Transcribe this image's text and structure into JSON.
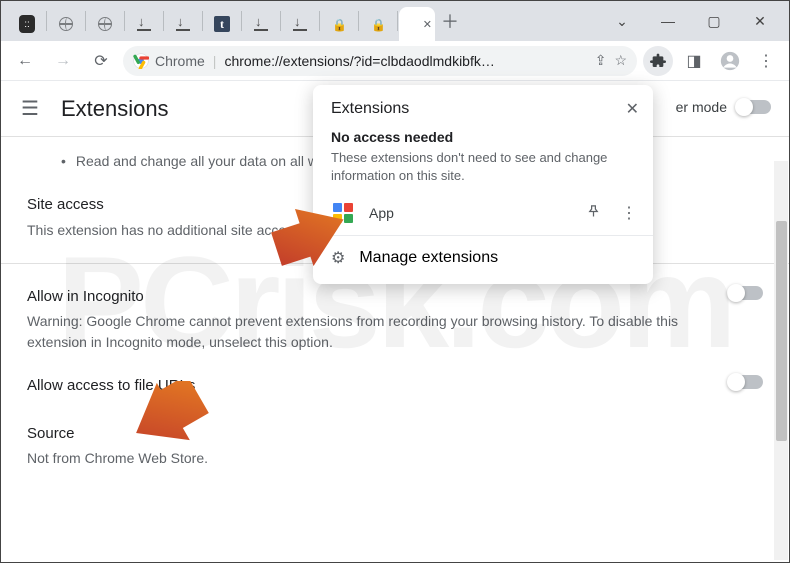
{
  "window": {
    "tabs": [
      {
        "icon": "bot"
      },
      {
        "icon": "globe"
      },
      {
        "icon": "globe"
      },
      {
        "icon": "dl"
      },
      {
        "icon": "dl"
      },
      {
        "icon": "t"
      },
      {
        "icon": "dl"
      },
      {
        "icon": "dl"
      },
      {
        "icon": "lock"
      },
      {
        "icon": "lock"
      },
      {
        "icon": "active",
        "active": true
      }
    ]
  },
  "omnibox": {
    "scheme_label": "Chrome",
    "url": "chrome://extensions/?id=clbdaodlmdkibfk…"
  },
  "page": {
    "title": "Extensions",
    "dev_mode_label": "er mode",
    "bullet": "Read and change all your data on all w",
    "site_access": {
      "title": "Site access",
      "text": "This extension has no additional site acce"
    },
    "incognito": {
      "title": "Allow in Incognito",
      "text": "Warning: Google Chrome cannot prevent extensions from recording your browsing history. To disable this extension in Incognito mode, unselect this option."
    },
    "file_urls": {
      "title": "Allow access to file URLs"
    },
    "source": {
      "title": "Source",
      "text": "Not from Chrome Web Store."
    }
  },
  "popup": {
    "title": "Extensions",
    "no_access_title": "No access needed",
    "no_access_text": "These extensions don't need to see and change information on this site.",
    "app_label": "App",
    "manage_label": "Manage extensions"
  },
  "watermark": "PCrisk.com"
}
